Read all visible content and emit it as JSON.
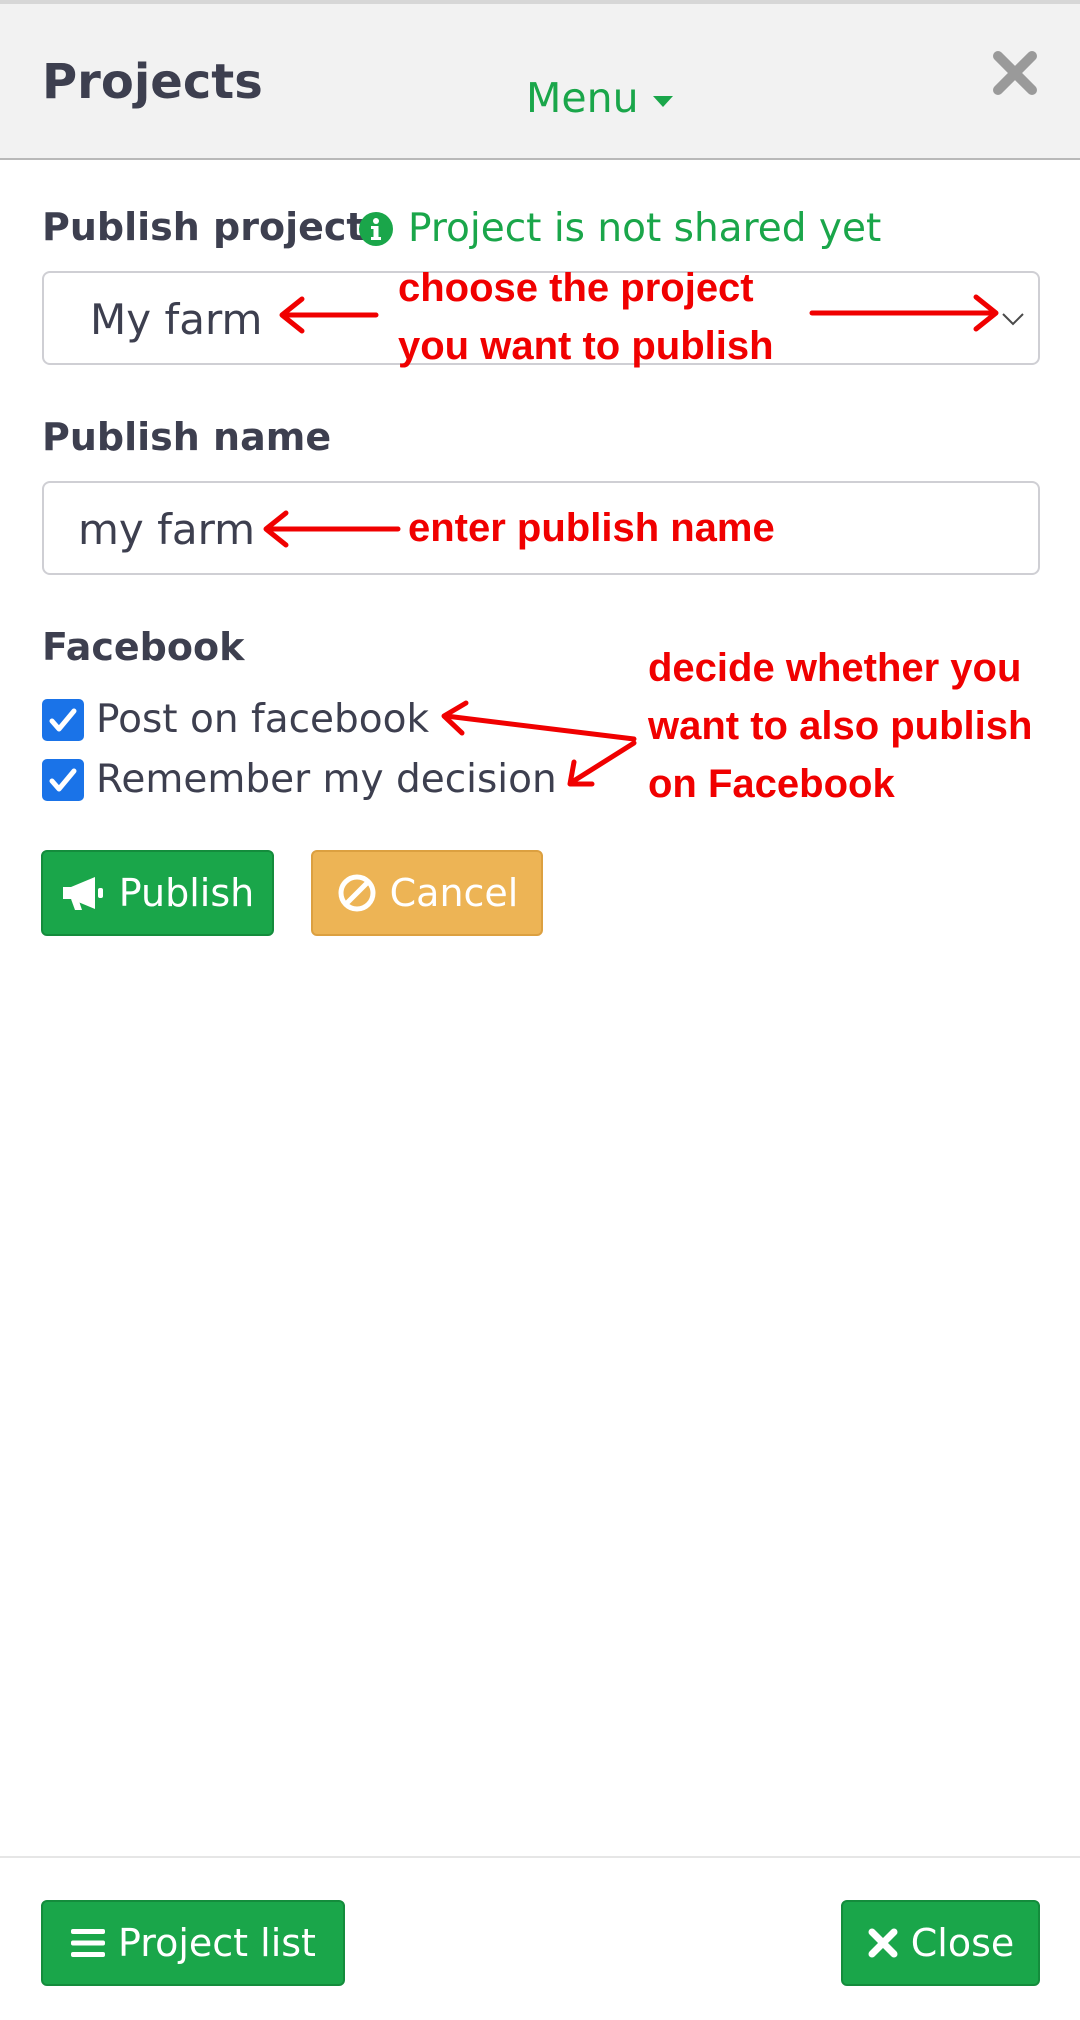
{
  "header": {
    "title": "Projects",
    "menu_label": "Menu"
  },
  "form": {
    "publish_project_label": "Publish project",
    "status_text": "Project is not shared yet",
    "project_select_value": "My farm",
    "publish_name_label": "Publish name",
    "publish_name_value": "my farm",
    "facebook_label": "Facebook",
    "checkboxes": [
      {
        "label": "Post on facebook",
        "checked": true
      },
      {
        "label": "Remember my decision",
        "checked": true
      }
    ]
  },
  "actions": {
    "publish_label": "Publish",
    "cancel_label": "Cancel"
  },
  "annotations": {
    "choose_line1": "choose the project",
    "choose_line2": "you want to publish",
    "enter_name": "enter publish name",
    "decide_line1": "decide whether you",
    "decide_line2": "want to also publish",
    "decide_line3": "on Facebook"
  },
  "footer": {
    "project_list_label": "Project list",
    "close_label": "Close"
  },
  "colors": {
    "accent_green": "#1aa64a",
    "cancel_orange": "#edb455",
    "checkbox_blue": "#1a73e8",
    "annotation_red": "#f00000"
  },
  "icons": [
    "close-icon",
    "caret-down-icon",
    "info-icon",
    "chevron-down-icon",
    "checkmark-icon",
    "megaphone-icon",
    "ban-icon",
    "list-icon",
    "times-icon"
  ]
}
